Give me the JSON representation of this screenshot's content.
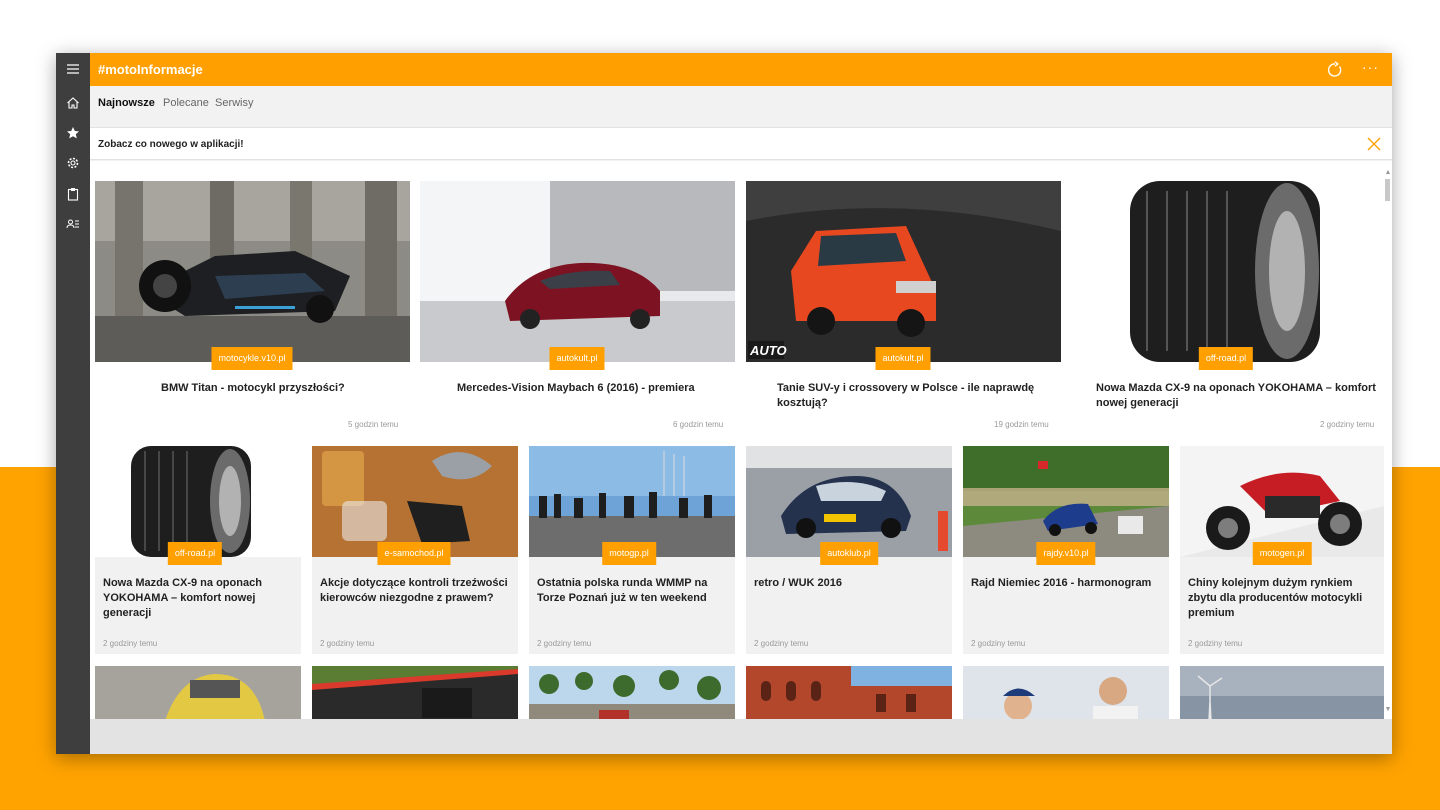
{
  "app": {
    "title": "#motoInformacje"
  },
  "sidebar": {
    "items": [
      {
        "icon": "hamburger-menu-icon"
      },
      {
        "icon": "home-icon"
      },
      {
        "icon": "star-icon"
      },
      {
        "icon": "gear-icon"
      },
      {
        "icon": "clipboard-icon"
      },
      {
        "icon": "contact-list-icon"
      }
    ]
  },
  "tabs": [
    {
      "label": "Najnowsze",
      "active": true
    },
    {
      "label": "Polecane",
      "active": false
    },
    {
      "label": "Serwisy",
      "active": false
    }
  ],
  "notice": {
    "text": "Zobacz co nowego w aplikacji!"
  },
  "row1": [
    {
      "source": "motocykle.v10.pl",
      "title": "BMW Titan - motocykl przyszłości?",
      "time": "5 godzin temu"
    },
    {
      "source": "autokult.pl",
      "title": "Mercedes-Vision Maybach 6 (2016) - premiera",
      "time": "6 godzin temu"
    },
    {
      "source": "autokult.pl",
      "title": "Tanie SUV-y i crossovery w Polsce - ile naprawdę kosztują?",
      "time": "19 godzin temu"
    },
    {
      "source": "off-road.pl",
      "title": "Nowa Mazda CX-9 na oponach YOKOHAMA – komfort nowej generacji",
      "time": "2 godziny temu"
    }
  ],
  "row2": [
    {
      "source": "off-road.pl",
      "title": "Nowa Mazda CX-9 na oponach YOKOHAMA – komfort nowej generacji",
      "time": "2 godziny temu"
    },
    {
      "source": "e-samochod.pl",
      "title": "Akcje dotyczące kontroli trzeźwości kierowców niezgodne z prawem?",
      "time": "2 godziny temu"
    },
    {
      "source": "motogp.pl",
      "title": "Ostatnia polska runda WMMP na Torze Poznań już w ten weekend",
      "time": "2 godziny temu"
    },
    {
      "source": "autoklub.pl",
      "title": "retro / WUK 2016",
      "time": "2 godziny temu"
    },
    {
      "source": "rajdy.v10.pl",
      "title": "Rajd Niemiec 2016 - harmonogram",
      "time": "2 godziny temu"
    },
    {
      "source": "motogen.pl",
      "title": "Chiny kolejnym dużym rynkiem zbytu dla producentów motocykli premium",
      "time": "2 godziny temu"
    }
  ],
  "image_watermark": "AUTO",
  "colors": {
    "accent": "#ffa000",
    "sidebar": "#3e3e3e",
    "page_bottom": "#ffa300"
  }
}
